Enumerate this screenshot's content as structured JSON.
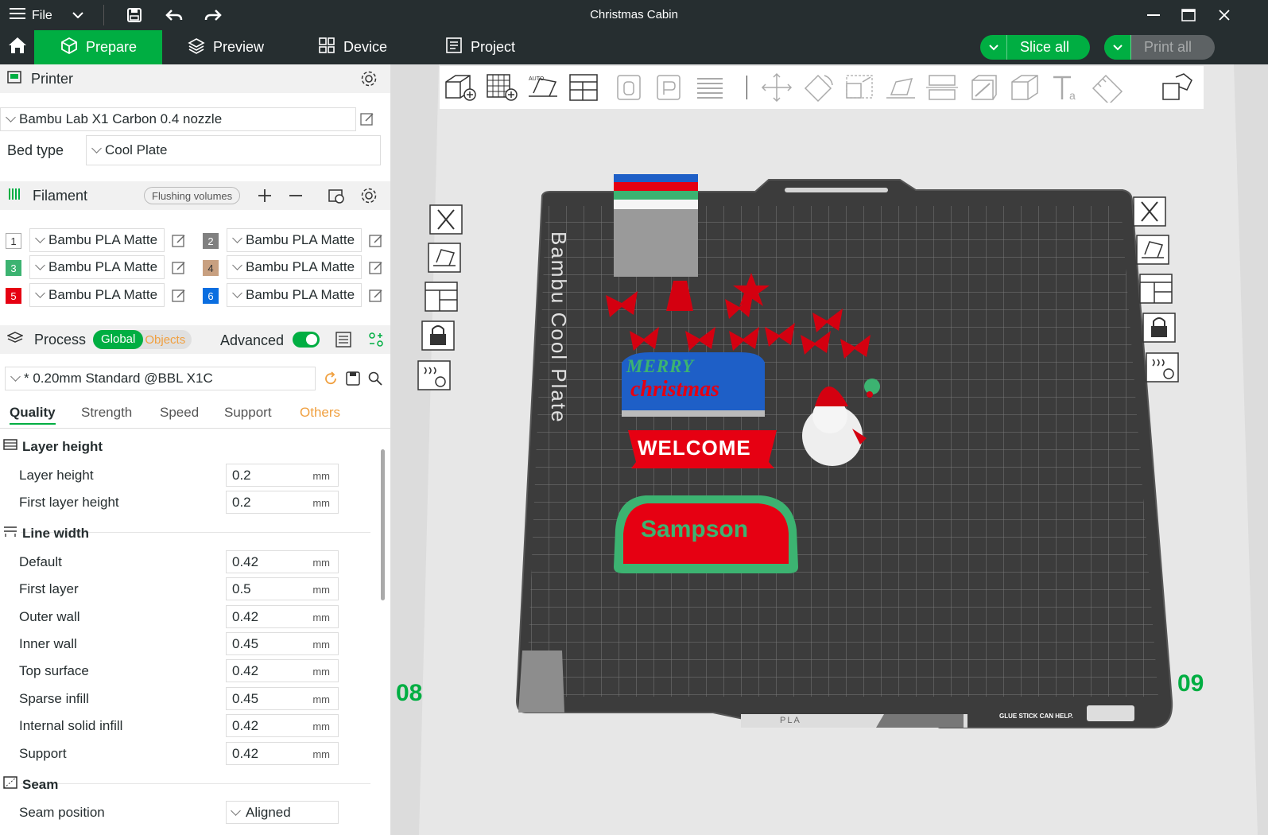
{
  "window": {
    "title": "Christmas Cabin",
    "file_menu": "File"
  },
  "tabs": [
    {
      "label": "Prepare",
      "active": true
    },
    {
      "label": "Preview",
      "active": false
    },
    {
      "label": "Device",
      "active": false
    },
    {
      "label": "Project",
      "active": false
    }
  ],
  "actions": {
    "slice": "Slice all",
    "print": "Print all"
  },
  "printer": {
    "section_title": "Printer",
    "model": "Bambu Lab X1 Carbon 0.4 nozzle",
    "bed_type_label": "Bed type",
    "bed_type": "Cool Plate"
  },
  "filament": {
    "section_title": "Filament",
    "flushing_button": "Flushing volumes",
    "slots": [
      {
        "num": "1",
        "name": "Bambu PLA Matte",
        "color": "#ffffff"
      },
      {
        "num": "2",
        "name": "Bambu PLA Matte",
        "color": "#808080"
      },
      {
        "num": "3",
        "name": "Bambu PLA Matte",
        "color": "#3cb371"
      },
      {
        "num": "4",
        "name": "Bambu PLA Matte",
        "color": "#c8a080"
      },
      {
        "num": "5",
        "name": "Bambu PLA Matte",
        "color": "#e60012"
      },
      {
        "num": "6",
        "name": "Bambu PLA Matte",
        "color": "#0a6ee0"
      }
    ]
  },
  "process": {
    "section_title": "Process",
    "toggle_global": "Global",
    "toggle_objects": "Objects",
    "advanced_label": "Advanced",
    "advanced_on": true,
    "preset": "* 0.20mm Standard @BBL X1C"
  },
  "subtabs": [
    "Quality",
    "Strength",
    "Speed",
    "Support",
    "Others"
  ],
  "settings": {
    "layer_height_group": "Layer height",
    "layer_height": {
      "label": "Layer height",
      "value": "0.2",
      "unit": "mm"
    },
    "first_layer_height": {
      "label": "First layer height",
      "value": "0.2",
      "unit": "mm"
    },
    "line_width_group": "Line width",
    "default": {
      "label": "Default",
      "value": "0.42",
      "unit": "mm"
    },
    "first_layer": {
      "label": "First layer",
      "value": "0.5",
      "unit": "mm"
    },
    "outer_wall": {
      "label": "Outer wall",
      "value": "0.42",
      "unit": "mm"
    },
    "inner_wall": {
      "label": "Inner wall",
      "value": "0.45",
      "unit": "mm"
    },
    "top_surface": {
      "label": "Top surface",
      "value": "0.42",
      "unit": "mm"
    },
    "sparse_infill": {
      "label": "Sparse infill",
      "value": "0.45",
      "unit": "mm"
    },
    "internal_solid_infill": {
      "label": "Internal solid infill",
      "value": "0.42",
      "unit": "mm"
    },
    "support": {
      "label": "Support",
      "value": "0.42",
      "unit": "mm"
    },
    "seam_group": "Seam",
    "seam_position": {
      "label": "Seam position",
      "value": "Aligned"
    }
  },
  "viewport": {
    "plate_label": "Bambu Cool Plate",
    "plate_left_num": "08",
    "plate_right_num": "09",
    "plate_material": "PLA",
    "plate_notice": "GLUE STICK CAN HELP.",
    "models": {
      "merry": "MERRY",
      "christmas": "christmas",
      "welcome": "WELCOME",
      "name_sign": "Sampson"
    }
  },
  "colors": {
    "brand": "#00ae42",
    "dark": "#262e30",
    "accent_orange": "#f0a040"
  }
}
